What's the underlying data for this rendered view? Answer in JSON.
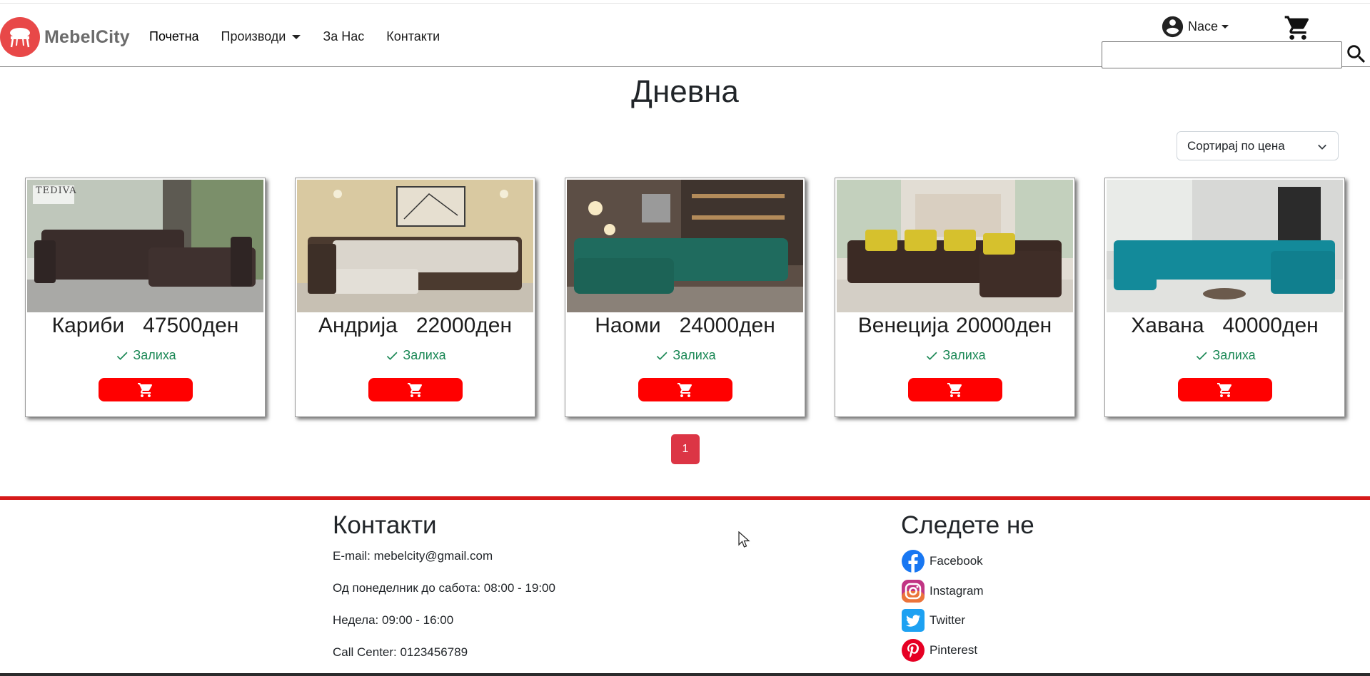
{
  "brand": {
    "name": "MebelCity",
    "logo_icon": "chair-icon",
    "accent": "#e84848"
  },
  "nav": {
    "items": [
      {
        "label": "Почетна",
        "active": true
      },
      {
        "label": "Производи",
        "dropdown": true
      },
      {
        "label": "За Нас"
      },
      {
        "label": "Контакти"
      }
    ]
  },
  "user": {
    "name": "Nace",
    "icon": "user-circle-icon"
  },
  "cart": {
    "icon": "cart-icon"
  },
  "search": {
    "value": "",
    "placeholder": "",
    "icon": "search-icon"
  },
  "page": {
    "title": "Дневна"
  },
  "sort": {
    "selected": "Сортирај по цена"
  },
  "products": [
    {
      "name": "Кариби",
      "price": "47500ден",
      "stock": "Залиха",
      "image_caption": "TEDIVA"
    },
    {
      "name": "Андрија",
      "price": "22000ден",
      "stock": "Залиха"
    },
    {
      "name": "Наоми",
      "price": "24000ден",
      "stock": "Залиха"
    },
    {
      "name": "Венеција",
      "price": "20000ден",
      "stock": "Залиха"
    },
    {
      "name": "Хавана",
      "price": "40000ден",
      "stock": "Залиха"
    }
  ],
  "pagination": {
    "current": "1"
  },
  "footer": {
    "contacts": {
      "title": "Контакти",
      "email": "E-mail: mebelcity@gmail.com",
      "weekdays": "Од понеделник до сабота: 08:00 - 19:00",
      "sunday": "Недела: 09:00 - 16:00",
      "call_center": "Call Center: 0123456789"
    },
    "follow": {
      "title": "Следете не",
      "links": [
        {
          "label": "Facebook",
          "icon": "facebook-icon"
        },
        {
          "label": "Instagram",
          "icon": "instagram-icon"
        },
        {
          "label": "Twitter",
          "icon": "twitter-icon"
        },
        {
          "label": "Pinterest",
          "icon": "pinterest-icon"
        }
      ]
    }
  },
  "colors": {
    "button_red": "#ff0000",
    "pager_red": "#dc3545",
    "stock_green": "#198754",
    "footer_border": "#d61a1a"
  }
}
